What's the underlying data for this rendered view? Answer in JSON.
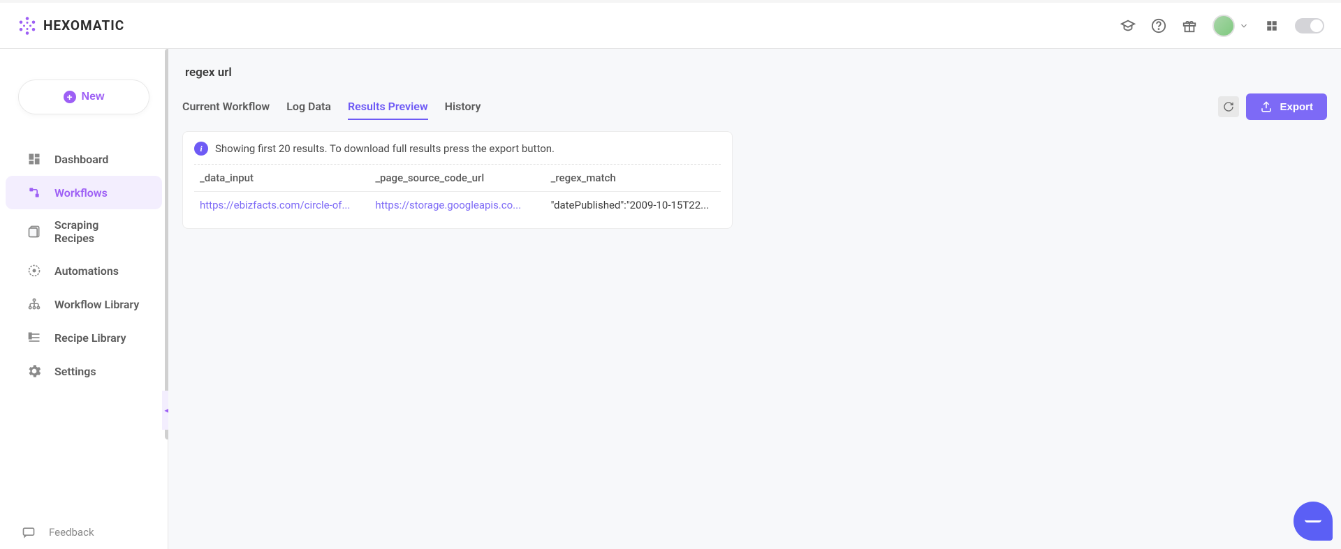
{
  "brand": {
    "name": "HEXOMATIC"
  },
  "sidebar": {
    "new_label": "New",
    "items": [
      {
        "label": "Dashboard"
      },
      {
        "label": "Workflows"
      },
      {
        "label": "Scraping Recipes"
      },
      {
        "label": "Automations"
      },
      {
        "label": "Workflow Library"
      },
      {
        "label": "Recipe Library"
      },
      {
        "label": "Settings"
      }
    ],
    "feedback_label": "Feedback"
  },
  "page": {
    "title": "regex url"
  },
  "tabs": {
    "items": [
      {
        "label": "Current Workflow"
      },
      {
        "label": "Log Data"
      },
      {
        "label": "Results Preview"
      },
      {
        "label": "History"
      }
    ],
    "active_index": 2
  },
  "actions": {
    "export_label": "Export"
  },
  "results": {
    "info_text": "Showing first 20 results. To download full results press the export button.",
    "columns": [
      "_data_input",
      "_page_source_code_url",
      "_regex_match"
    ],
    "rows": [
      {
        "data_input": "https://ebizfacts.com/circle-of...",
        "page_source": "https://storage.googleapis.co...",
        "regex_match": "\"datePublished\":\"2009-10-15T22..."
      }
    ]
  }
}
